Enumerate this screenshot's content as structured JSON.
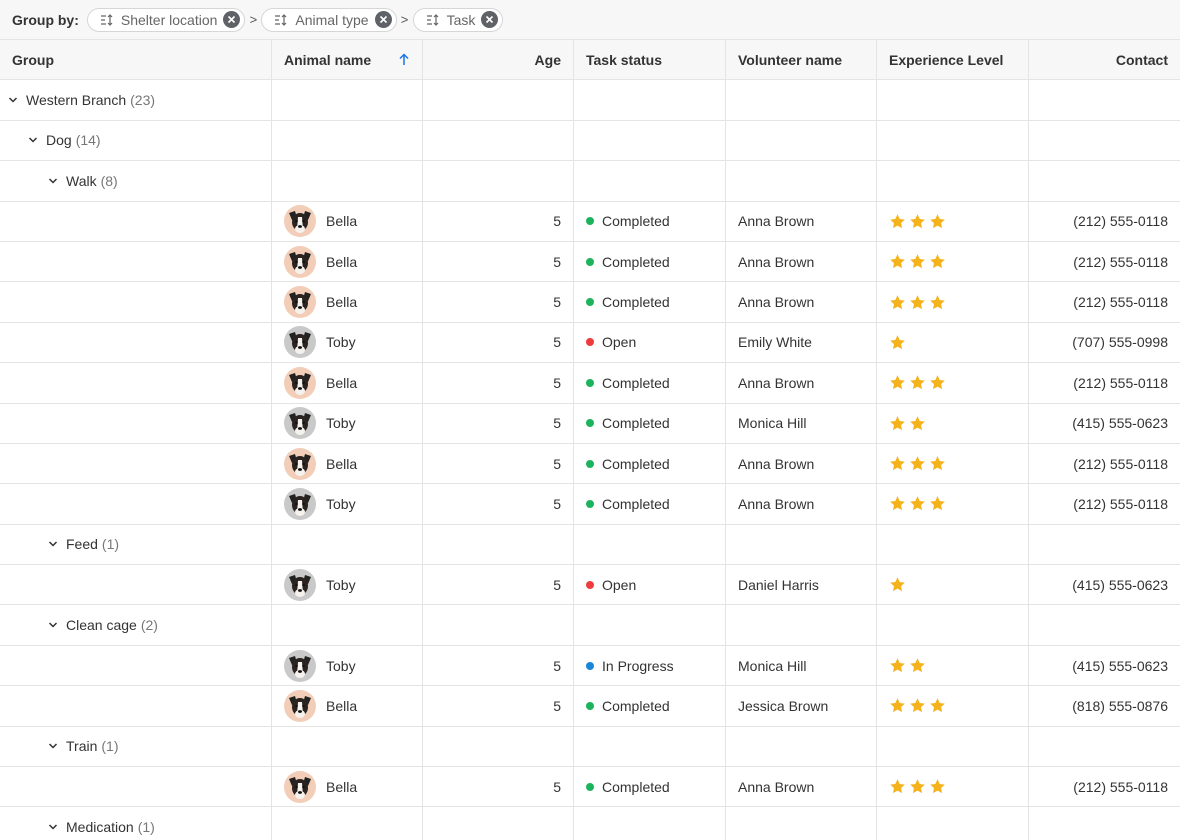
{
  "groupBy": {
    "label": "Group by:",
    "chips": [
      {
        "label": "Shelter location"
      },
      {
        "label": "Animal type"
      },
      {
        "label": "Task"
      }
    ]
  },
  "colors": {
    "completed": "#1db35d",
    "open": "#ef3b3b",
    "in_progress": "#1a86d8",
    "star": "#f4b31d",
    "sort": "#1a73e8"
  },
  "columns": [
    "Group",
    "Animal name",
    "Age",
    "Task status",
    "Volunteer name",
    "Experience Level",
    "Contact"
  ],
  "rows": [
    {
      "type": "group",
      "level": 1,
      "label": "Western Branch",
      "count": "(23)"
    },
    {
      "type": "group",
      "level": 2,
      "label": "Dog",
      "count": "(14)"
    },
    {
      "type": "group",
      "level": 3,
      "label": "Walk",
      "count": "(8)"
    },
    {
      "type": "data",
      "animal": "Bella",
      "avatar": "bella",
      "age": "5",
      "status": "Completed",
      "statusKey": "completed",
      "volunteer": "Anna Brown",
      "stars": 3,
      "contact": "(212) 555-0118"
    },
    {
      "type": "data",
      "animal": "Bella",
      "avatar": "bella",
      "age": "5",
      "status": "Completed",
      "statusKey": "completed",
      "volunteer": "Anna Brown",
      "stars": 3,
      "contact": "(212) 555-0118"
    },
    {
      "type": "data",
      "animal": "Bella",
      "avatar": "bella",
      "age": "5",
      "status": "Completed",
      "statusKey": "completed",
      "volunteer": "Anna Brown",
      "stars": 3,
      "contact": "(212) 555-0118"
    },
    {
      "type": "data",
      "animal": "Toby",
      "avatar": "toby",
      "age": "5",
      "status": "Open",
      "statusKey": "open",
      "volunteer": "Emily White",
      "stars": 1,
      "contact": "(707) 555-0998"
    },
    {
      "type": "data",
      "animal": "Bella",
      "avatar": "bella",
      "age": "5",
      "status": "Completed",
      "statusKey": "completed",
      "volunteer": "Anna Brown",
      "stars": 3,
      "contact": "(212) 555-0118"
    },
    {
      "type": "data",
      "animal": "Toby",
      "avatar": "toby",
      "age": "5",
      "status": "Completed",
      "statusKey": "completed",
      "volunteer": "Monica Hill",
      "stars": 2,
      "contact": "(415) 555-0623"
    },
    {
      "type": "data",
      "animal": "Bella",
      "avatar": "bella",
      "age": "5",
      "status": "Completed",
      "statusKey": "completed",
      "volunteer": "Anna Brown",
      "stars": 3,
      "contact": "(212) 555-0118"
    },
    {
      "type": "data",
      "animal": "Toby",
      "avatar": "toby",
      "age": "5",
      "status": "Completed",
      "statusKey": "completed",
      "volunteer": "Anna Brown",
      "stars": 3,
      "contact": "(212) 555-0118"
    },
    {
      "type": "group",
      "level": 3,
      "label": "Feed",
      "count": "(1)"
    },
    {
      "type": "data",
      "animal": "Toby",
      "avatar": "toby",
      "age": "5",
      "status": "Open",
      "statusKey": "open",
      "volunteer": "Daniel Harris",
      "stars": 1,
      "contact": "(415) 555-0623"
    },
    {
      "type": "group",
      "level": 3,
      "label": "Clean cage",
      "count": "(2)"
    },
    {
      "type": "data",
      "animal": "Toby",
      "avatar": "toby",
      "age": "5",
      "status": "In Progress",
      "statusKey": "in_progress",
      "volunteer": "Monica Hill",
      "stars": 2,
      "contact": "(415) 555-0623"
    },
    {
      "type": "data",
      "animal": "Bella",
      "avatar": "bella",
      "age": "5",
      "status": "Completed",
      "statusKey": "completed",
      "volunteer": "Jessica Brown",
      "stars": 3,
      "contact": "(818) 555-0876"
    },
    {
      "type": "group",
      "level": 3,
      "label": "Train",
      "count": "(1)"
    },
    {
      "type": "data",
      "animal": "Bella",
      "avatar": "bella",
      "age": "5",
      "status": "Completed",
      "statusKey": "completed",
      "volunteer": "Anna Brown",
      "stars": 3,
      "contact": "(212) 555-0118"
    },
    {
      "type": "group",
      "level": 3,
      "label": "Medication",
      "count": "(1)"
    }
  ]
}
